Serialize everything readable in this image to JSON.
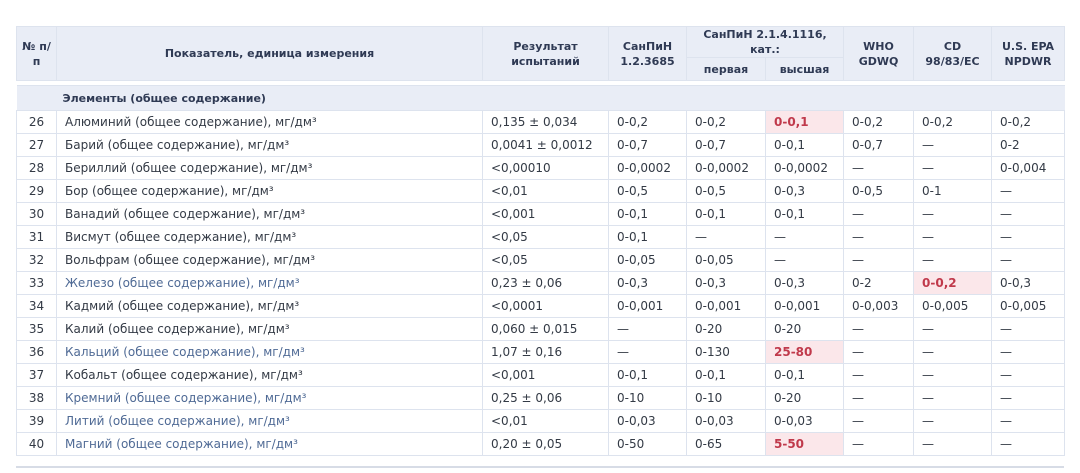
{
  "header": {
    "num": "№ п/п",
    "indicator": "Показатель, единица измерения",
    "result": "Результат испытаний",
    "sanpin_a": "СанПиН 1.2.3685",
    "sanpin_b": "СанПиН 2.1.4.1116, кат.:",
    "sanpin_b_first": "первая",
    "sanpin_b_high": "высшая",
    "who": "WHO GDWQ",
    "cd": "CD 98/83/EC",
    "epa": "U.S. EPA NPDWR"
  },
  "section_title": "Элементы (общее содержание)",
  "rows": [
    {
      "num": "26",
      "name": "Алюминий (общее содержание), мг/дм³",
      "result": "0,135 ± 0,034",
      "sanpin": "0-0,2",
      "first": "0-0,2",
      "high": "0-0,1",
      "who": "0-0,2",
      "cd": "0-0,2",
      "epa": "0-0,2",
      "highlight": "high",
      "link": false
    },
    {
      "num": "27",
      "name": "Барий (общее содержание), мг/дм³",
      "result": "0,0041 ± 0,0012",
      "sanpin": "0-0,7",
      "first": "0-0,7",
      "high": "0-0,1",
      "who": "0-0,7",
      "cd": "—",
      "epa": "0-2",
      "highlight": "",
      "link": false
    },
    {
      "num": "28",
      "name": "Бериллий (общее содержание), мг/дм³",
      "result": "<0,00010",
      "sanpin": "0-0,0002",
      "first": "0-0,0002",
      "high": "0-0,0002",
      "who": "—",
      "cd": "—",
      "epa": "0-0,004",
      "highlight": "",
      "link": false
    },
    {
      "num": "29",
      "name": "Бор (общее содержание), мг/дм³",
      "result": "<0,01",
      "sanpin": "0-0,5",
      "first": "0-0,5",
      "high": "0-0,3",
      "who": "0-0,5",
      "cd": "0-1",
      "epa": "—",
      "highlight": "",
      "link": false
    },
    {
      "num": "30",
      "name": "Ванадий (общее содержание), мг/дм³",
      "result": "<0,001",
      "sanpin": "0-0,1",
      "first": "0-0,1",
      "high": "0-0,1",
      "who": "—",
      "cd": "—",
      "epa": "—",
      "highlight": "",
      "link": false
    },
    {
      "num": "31",
      "name": "Висмут (общее содержание), мг/дм³",
      "result": "<0,05",
      "sanpin": "0-0,1",
      "first": "—",
      "high": "—",
      "who": "—",
      "cd": "—",
      "epa": "—",
      "highlight": "",
      "link": false
    },
    {
      "num": "32",
      "name": "Вольфрам (общее содержание), мг/дм³",
      "result": "<0,05",
      "sanpin": "0-0,05",
      "first": "0-0,05",
      "high": "—",
      "who": "—",
      "cd": "—",
      "epa": "—",
      "highlight": "",
      "link": false
    },
    {
      "num": "33",
      "name": "Железо (общее содержание), мг/дм³",
      "result": "0,23 ± 0,06",
      "sanpin": "0-0,3",
      "first": "0-0,3",
      "high": "0-0,3",
      "who": "0-2",
      "cd": "0-0,2",
      "epa": "0-0,3",
      "highlight": "cd",
      "link": true
    },
    {
      "num": "34",
      "name": "Кадмий (общее содержание), мг/дм³",
      "result": "<0,0001",
      "sanpin": "0-0,001",
      "first": "0-0,001",
      "high": "0-0,001",
      "who": "0-0,003",
      "cd": "0-0,005",
      "epa": "0-0,005",
      "highlight": "",
      "link": false
    },
    {
      "num": "35",
      "name": "Калий (общее содержание), мг/дм³",
      "result": "0,060 ± 0,015",
      "sanpin": "—",
      "first": "0-20",
      "high": "0-20",
      "who": "—",
      "cd": "—",
      "epa": "—",
      "highlight": "",
      "link": false
    },
    {
      "num": "36",
      "name": "Кальций (общее содержание), мг/дм³",
      "result": "1,07 ± 0,16",
      "sanpin": "—",
      "first": "0-130",
      "high": "25-80",
      "who": "—",
      "cd": "—",
      "epa": "—",
      "highlight": "high",
      "link": true
    },
    {
      "num": "37",
      "name": "Кобальт (общее содержание), мг/дм³",
      "result": "<0,001",
      "sanpin": "0-0,1",
      "first": "0-0,1",
      "high": "0-0,1",
      "who": "—",
      "cd": "—",
      "epa": "—",
      "highlight": "",
      "link": false
    },
    {
      "num": "38",
      "name": "Кремний (общее содержание), мг/дм³",
      "result": "0,25 ± 0,06",
      "sanpin": "0-10",
      "first": "0-10",
      "high": "0-20",
      "who": "—",
      "cd": "—",
      "epa": "—",
      "highlight": "",
      "link": true
    },
    {
      "num": "39",
      "name": "Литий (общее содержание), мг/дм³",
      "result": "<0,01",
      "sanpin": "0-0,03",
      "first": "0-0,03",
      "high": "0-0,03",
      "who": "—",
      "cd": "—",
      "epa": "—",
      "highlight": "",
      "link": true
    },
    {
      "num": "40",
      "name": "Магний (общее содержание), мг/дм³",
      "result": "0,20 ± 0,05",
      "sanpin": "0-50",
      "first": "0-65",
      "high": "5-50",
      "who": "—",
      "cd": "—",
      "epa": "—",
      "highlight": "high",
      "link": true
    }
  ]
}
